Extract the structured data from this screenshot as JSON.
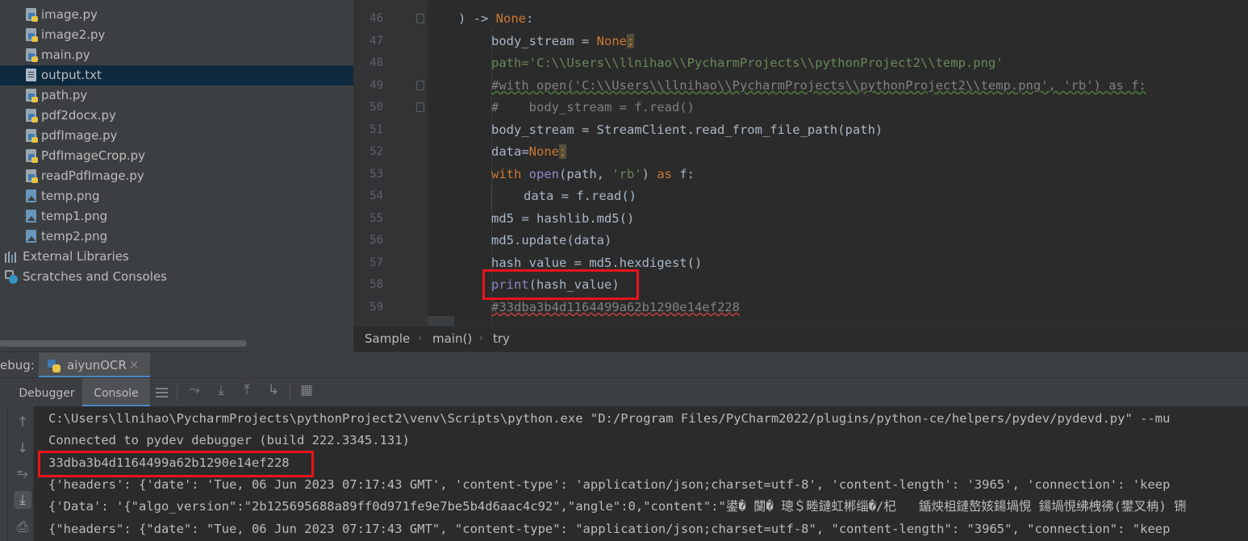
{
  "project_tree": {
    "items": [
      {
        "label": "image.py",
        "icon": "python-file-icon",
        "selected": false
      },
      {
        "label": "image2.py",
        "icon": "python-file-icon",
        "selected": false
      },
      {
        "label": "main.py",
        "icon": "python-file-icon",
        "selected": false
      },
      {
        "label": "output.txt",
        "icon": "text-file-icon",
        "selected": true
      },
      {
        "label": "path.py",
        "icon": "python-file-icon",
        "selected": false
      },
      {
        "label": "pdf2docx.py",
        "icon": "python-file-icon",
        "selected": false
      },
      {
        "label": "pdfImage.py",
        "icon": "python-file-icon",
        "selected": false
      },
      {
        "label": "PdfImageCrop.py",
        "icon": "python-file-icon",
        "selected": false
      },
      {
        "label": "readPdfImage.py",
        "icon": "python-file-icon",
        "selected": false
      },
      {
        "label": "temp.png",
        "icon": "image-file-icon",
        "selected": false
      },
      {
        "label": "temp1.png",
        "icon": "image-file-icon",
        "selected": false
      },
      {
        "label": "temp2.png",
        "icon": "image-file-icon",
        "selected": false
      },
      {
        "label": "External Libraries",
        "icon": "library-icon",
        "selected": false
      },
      {
        "label": "Scratches and Consoles",
        "icon": "scratches-icon",
        "selected": false
      }
    ]
  },
  "editor": {
    "lines": [
      {
        "num": "46",
        "code": ") -> None:"
      },
      {
        "num": "47",
        "code": "body_stream = None;"
      },
      {
        "num": "48",
        "code": "path='C:\\\\Users\\\\llnihao\\\\PycharmProjects\\\\pythonProject2\\\\temp.png'"
      },
      {
        "num": "49",
        "code": "#with open('C:\\\\Users\\\\llnihao\\\\PycharmProjects\\\\pythonProject2\\\\temp.png', 'rb') as f:"
      },
      {
        "num": "50",
        "code": "#    body_stream = f.read()"
      },
      {
        "num": "51",
        "code": "body_stream = StreamClient.read_from_file_path(path)"
      },
      {
        "num": "52",
        "code": "data=None;"
      },
      {
        "num": "53",
        "code": "with open(path, 'rb') as f:"
      },
      {
        "num": "54",
        "code": "data = f.read()"
      },
      {
        "num": "55",
        "code": "md5 = hashlib.md5()"
      },
      {
        "num": "56",
        "code": "md5.update(data)"
      },
      {
        "num": "57",
        "code": "hash_value = md5.hexdigest()"
      },
      {
        "num": "58",
        "code": "print(hash_value)"
      },
      {
        "num": "59",
        "code": "#33dba3b4d1164499a62b1290e14ef228"
      }
    ]
  },
  "breadcrumbs": [
    "Sample",
    "main()",
    "try"
  ],
  "debug": {
    "label": "ebug:",
    "run_tab": "aiyunOCR",
    "close_glyph": "×",
    "tabs": {
      "debugger": "Debugger",
      "console": "Console"
    },
    "console_lines": [
      "C:\\Users\\llnihao\\PycharmProjects\\pythonProject2\\venv\\Scripts\\python.exe \"D:/Program Files/PyCharm2022/plugins/python-ce/helpers/pydev/pydevd.py\" --mu",
      "Connected to pydev debugger (build 222.3345.131)",
      "33dba3b4d1164499a62b1290e14ef228",
      "{'headers': {'date': 'Tue, 06 Jun 2023 07:17:43 GMT', 'content-type': 'application/json;charset=utf-8', 'content-length': '3965', 'connection': 'keep",
      "{'Data': '{\"algo_version\":\"2b125695688a89ff0d971fe9e7be5b4d6aac4c92\",\"angle\":0,\"content\":\"鍙� 闅� 璁＄畻鏈虹郴缁�/杞   鍎炴柤鏈嶅姟鍚堝悓 鍚堝悓绋栧彿(鐢叉柟) 铏",
      "{\"headers\": {\"date\": \"Tue, 06 Jun 2023 07:17:43 GMT\", \"content-type\": \"application/json;charset=utf-8\", \"content-length\": \"3965\", \"connection\": \"keep"
    ]
  },
  "colors": {
    "highlight_box": "#e8141c",
    "selection": "#0d293e",
    "keyword": "#cc7832",
    "string": "#6a8759",
    "comment": "#808080",
    "builtin": "#8888c6"
  }
}
